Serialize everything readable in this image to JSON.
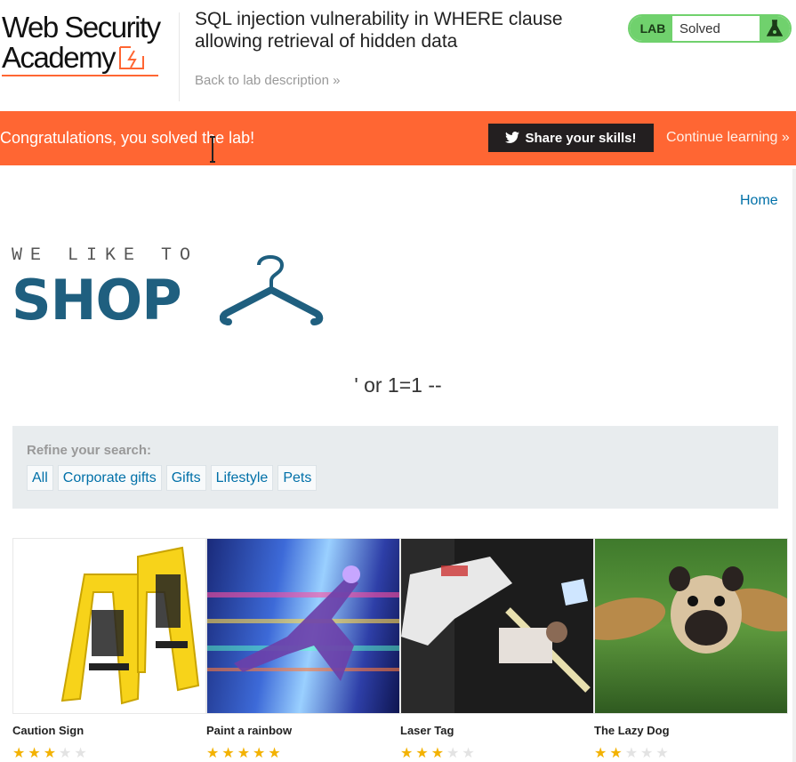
{
  "header": {
    "logo_line1": "Web Security",
    "logo_line2": "Academy",
    "lab_title": "SQL injection vulnerability in WHERE clause allowing retrieval of hidden data",
    "back_link": "Back to lab description »",
    "lab_badge": "LAB",
    "lab_status": "Solved"
  },
  "banner": {
    "message": "Congratulations, you solved the lab!",
    "share_label": "Share your skills!",
    "continue_label": "Continue learning »"
  },
  "nav": {
    "home": "Home"
  },
  "shop": {
    "tagline": "WE LIKE TO",
    "word": "SHOP",
    "search_term": "' or 1=1 --"
  },
  "filters": {
    "label": "Refine your search:",
    "categories": [
      "All",
      "Corporate gifts",
      "Gifts",
      "Lifestyle",
      "Pets"
    ]
  },
  "products": [
    {
      "name": "Caution Sign",
      "rating": 3
    },
    {
      "name": "Paint a rainbow",
      "rating": 5
    },
    {
      "name": "Laser Tag",
      "rating": 3
    },
    {
      "name": "The Lazy Dog",
      "rating": 2
    }
  ],
  "colors": {
    "brand_orange": "#ff6633",
    "solved_green": "#70d16d",
    "link_blue": "#0070a8",
    "shop_teal": "#1f5f7f"
  }
}
